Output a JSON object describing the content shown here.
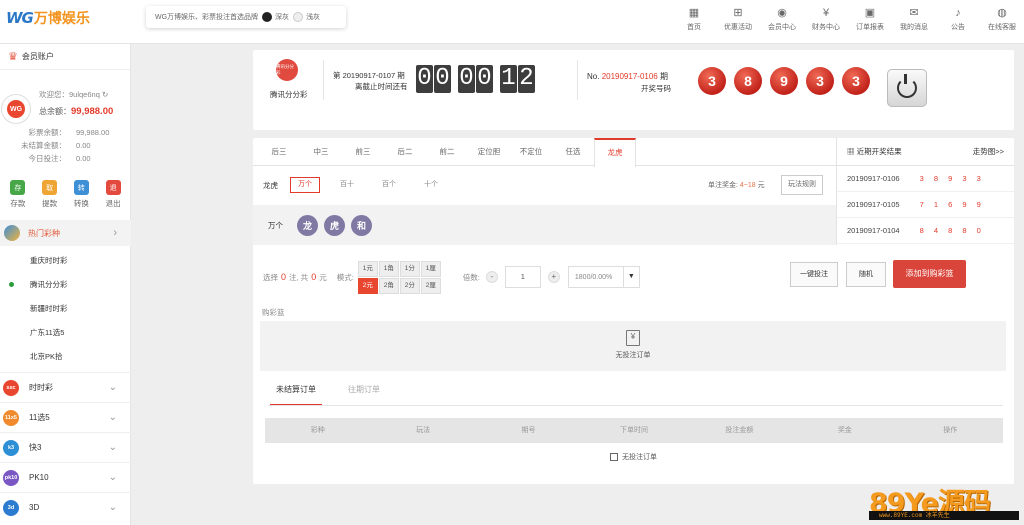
{
  "brand": {
    "logo_mark": "WG",
    "logo_text": "万博娱乐"
  },
  "theme": {
    "label": "WG万博娱乐、彩票投注首选品牌",
    "dark": "深灰",
    "light": "浅灰"
  },
  "nav": [
    {
      "label": "首页",
      "icon": "home-icon",
      "glyph": "▦"
    },
    {
      "label": "优惠活动",
      "icon": "gift-icon",
      "glyph": "⊞"
    },
    {
      "label": "会员中心",
      "icon": "user-icon",
      "glyph": "◉"
    },
    {
      "label": "财务中心",
      "icon": "finance-icon",
      "glyph": "¥"
    },
    {
      "label": "订单报表",
      "icon": "report-icon",
      "glyph": "▣"
    },
    {
      "label": "我的消息",
      "icon": "mail-icon",
      "glyph": "✉"
    },
    {
      "label": "公告",
      "icon": "bell-icon",
      "glyph": "♪"
    },
    {
      "label": "在线客服",
      "icon": "service-icon",
      "glyph": "◍"
    }
  ],
  "account": {
    "title": "会员账户",
    "welcome": "欢迎您：9ulqe6nq",
    "balance_label": "总余额：",
    "balance": "99,988.00",
    "stats": [
      {
        "k": "彩票余额：",
        "v": "99,988.00"
      },
      {
        "k": "未结算金额：",
        "v": "0.00"
      },
      {
        "k": "今日投注：",
        "v": "0.00"
      }
    ],
    "actions": [
      {
        "label": "存款",
        "icon": "存",
        "color": "#47a748"
      },
      {
        "label": "提款",
        "icon": "取",
        "color": "#eea534"
      },
      {
        "label": "转换",
        "icon": "转",
        "color": "#3d8fd6"
      },
      {
        "label": "退出",
        "icon": "退",
        "color": "#e34a3d"
      }
    ]
  },
  "menu": {
    "hot_label": "热门彩种",
    "hot_items": [
      "重庆时时彩",
      "腾讯分分彩",
      "新疆时时彩",
      "广东11选5",
      "北京PK拾"
    ],
    "categories": [
      {
        "label": "时时彩",
        "icon": "ssc",
        "color": "#e8462e"
      },
      {
        "label": "11选5",
        "icon": "11x5",
        "color": "#f08a2c"
      },
      {
        "label": "快3",
        "icon": "k3",
        "color": "#2d8fd5"
      },
      {
        "label": "PK10",
        "icon": "pk10",
        "color": "#7b57c4"
      },
      {
        "label": "3D",
        "icon": "3d",
        "color": "#2b7bd0"
      }
    ]
  },
  "draw": {
    "badge": "腾讯分分彩",
    "lottery_name": "腾讯分分彩",
    "issue_label": "第 20190917-0107 期",
    "closes_label": "离截止时间还有",
    "countdown": [
      "0",
      "0",
      "0",
      "0",
      "1",
      "2"
    ],
    "last_no_label": "No.",
    "last_issue": "20190917-0106",
    "last_suffix": "期",
    "draw_label": "开奖号码",
    "numbers": [
      "3",
      "8",
      "9",
      "3",
      "3"
    ]
  },
  "play": {
    "tabs": [
      "后三",
      "中三",
      "前三",
      "后二",
      "前二",
      "定位胆",
      "不定位",
      "任选",
      "龙虎"
    ],
    "active_tab": "龙虎",
    "sub_label": "龙虎",
    "sub_options": [
      "万个",
      "百十",
      "百个",
      "十个"
    ],
    "prize_label": "单注奖金:",
    "prize_value": "4~18",
    "prize_unit": "元",
    "rules_button": "玩法规则",
    "pick_position": "万个",
    "picks": [
      "龙",
      "虎",
      "和"
    ]
  },
  "recent": {
    "title": "近期开奖结果",
    "trend": "走势图>>",
    "rows": [
      {
        "issue": "20190917-0106",
        "nums": "3 8 9 3 3"
      },
      {
        "issue": "20190917-0105",
        "nums": "7 1 6 9 9"
      },
      {
        "issue": "20190917-0104",
        "nums": "8 4 8 8 0"
      }
    ]
  },
  "bet": {
    "select_label": "选择",
    "notes": "0",
    "notes_unit": "注, 共",
    "amount": "0",
    "amount_unit": "元",
    "mode_label": "模式:",
    "units": [
      "1元",
      "1角",
      "1分",
      "1厘",
      "2元",
      "2角",
      "2分",
      "2厘"
    ],
    "active_unit": "2元",
    "multiple_label": "倍数:",
    "multiple": "1",
    "rebate": "1800/0.00%",
    "one_click": "一键投注",
    "random": "随机",
    "add_cart": "添加到购彩篮"
  },
  "cart": {
    "label": "购彩篮",
    "empty": "无投注订单"
  },
  "orders": {
    "tabs": [
      "未结算订单",
      "往期订单"
    ],
    "columns": [
      "彩种",
      "玩法",
      "期号",
      "下单时间",
      "投注金额",
      "奖金",
      "操作"
    ],
    "empty": "无投注订单"
  },
  "watermark": {
    "big": "89Ye源码",
    "small": "www.89YE.com 冰羊先生"
  }
}
